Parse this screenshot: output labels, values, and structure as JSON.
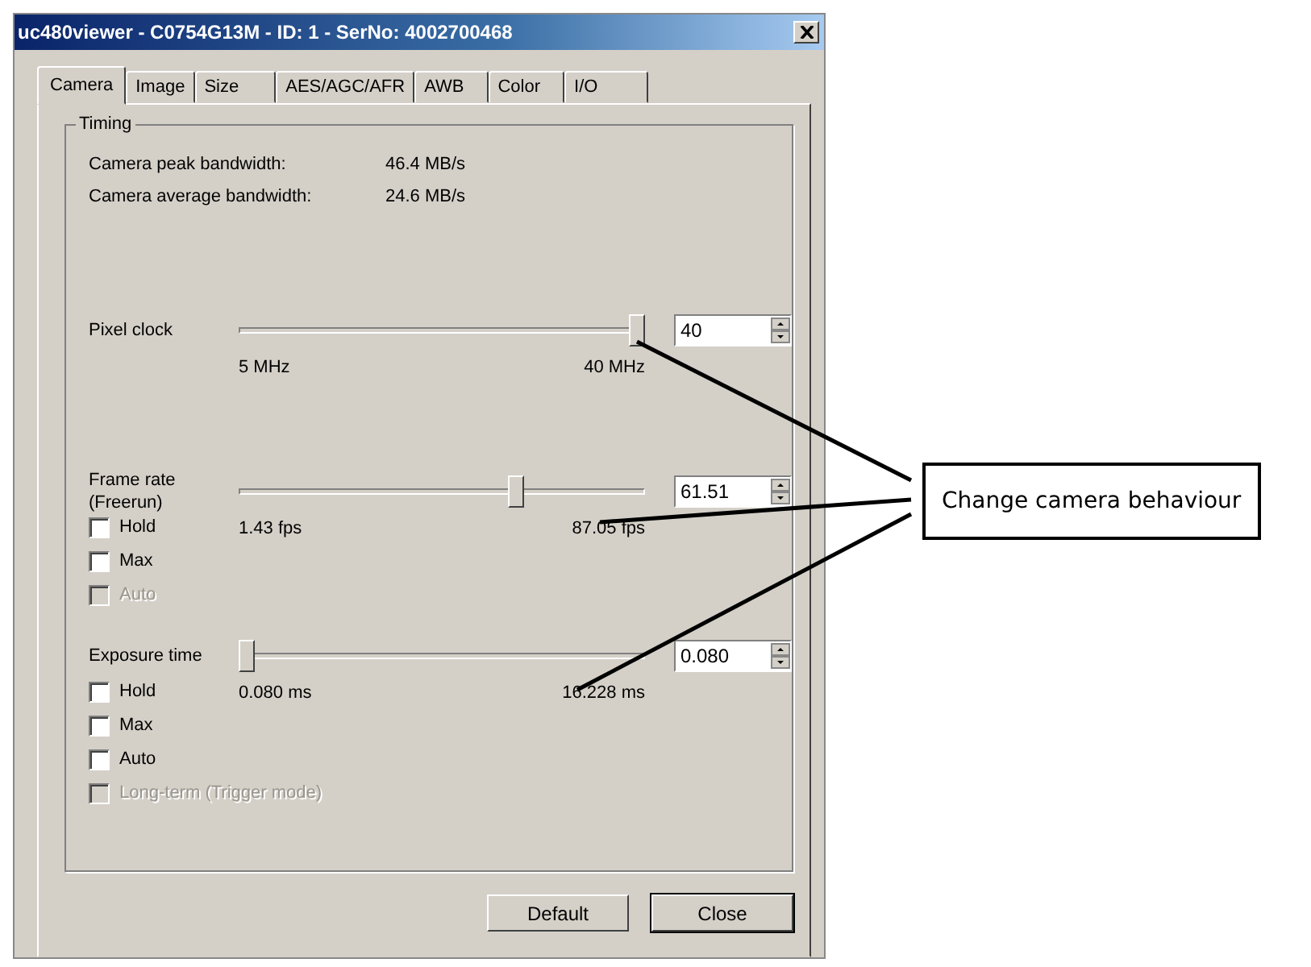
{
  "window": {
    "title": "uc480viewer - C0754G13M - ID: 1 - SerNo: 4002700468"
  },
  "tabs": [
    {
      "label": "Camera",
      "selected": true
    },
    {
      "label": "Image",
      "selected": false
    },
    {
      "label": "Size",
      "selected": false
    },
    {
      "label": "AES/AGC/AFR",
      "selected": false
    },
    {
      "label": "AWB",
      "selected": false
    },
    {
      "label": "Color",
      "selected": false
    },
    {
      "label": "I/O",
      "selected": false
    }
  ],
  "timing": {
    "title": "Timing",
    "stats": [
      {
        "label": "Camera peak bandwidth:",
        "value": "46.4 MB/s"
      },
      {
        "label": "Camera average bandwidth:",
        "value": "24.6 MB/s"
      }
    ],
    "controls": [
      {
        "label": "Pixel clock",
        "level": 1.0,
        "min_label": "5 MHz",
        "max_label": "40 MHz",
        "value": "40"
      },
      {
        "label": "Frame rate",
        "sublabel": "(Freerun)",
        "level": 0.69,
        "min_label": "1.43 fps",
        "max_label": "87.05 fps",
        "value": "61.51",
        "checkboxes": [
          {
            "label": "Hold",
            "checked": false,
            "disabled": false
          },
          {
            "label": "Max",
            "checked": false,
            "disabled": false
          },
          {
            "label": "Auto",
            "checked": false,
            "disabled": true
          }
        ]
      },
      {
        "label": "Exposure time",
        "level": 0.0,
        "min_label": "0.080 ms",
        "max_label": "16.228 ms",
        "value": "0.080",
        "checkboxes": [
          {
            "label": "Hold",
            "checked": false,
            "disabled": false
          },
          {
            "label": "Max",
            "checked": false,
            "disabled": false
          },
          {
            "label": "Auto",
            "checked": false,
            "disabled": false
          },
          {
            "label": "Long-term (Trigger mode)",
            "checked": false,
            "disabled": true
          }
        ]
      }
    ]
  },
  "buttons": [
    {
      "label": "Default",
      "default": false
    },
    {
      "label": "Close",
      "default": true
    }
  ],
  "callout": {
    "text": "Change camera behaviour"
  }
}
